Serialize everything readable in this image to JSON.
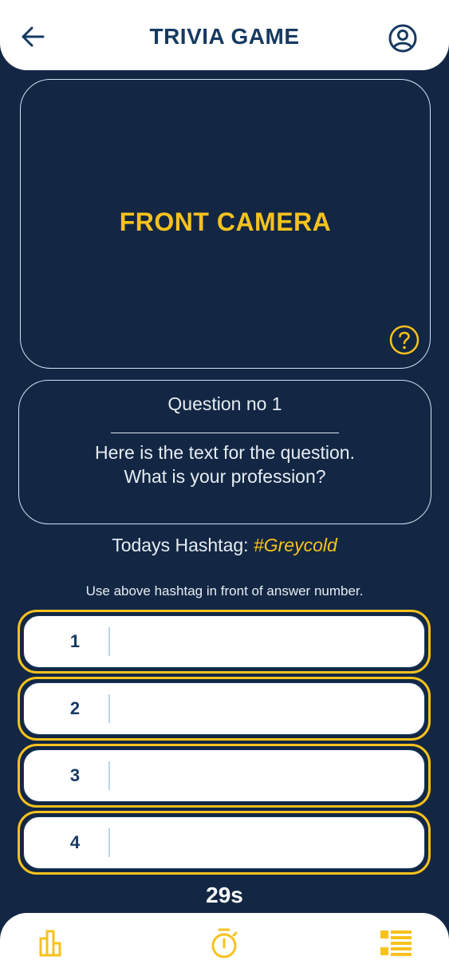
{
  "header": {
    "title": "TRIVIA GAME",
    "back_icon": "arrow-left-icon",
    "profile_icon": "user-circle-icon"
  },
  "camera": {
    "label": "FRONT CAMERA",
    "help_icon": "question-circle-icon"
  },
  "question": {
    "number_label": "Question no 1",
    "line1": "Here is the text for the question.",
    "line2": "What is your profession?"
  },
  "hashtag": {
    "prefix": "Todays Hashtag: ",
    "value": "#Greycold"
  },
  "instruction": "Use above hashtag in front of answer number.",
  "answers": [
    {
      "number": "1",
      "value": ""
    },
    {
      "number": "2",
      "value": ""
    },
    {
      "number": "3",
      "value": ""
    },
    {
      "number": "4",
      "value": ""
    }
  ],
  "timer": "29s",
  "nav": {
    "items": [
      {
        "icon": "bar-chart-icon"
      },
      {
        "icon": "stopwatch-icon"
      },
      {
        "icon": "list-icon"
      }
    ]
  },
  "colors": {
    "background": "#132744",
    "accent": "#f7c21d",
    "primary_text": "#173a61",
    "white": "#ffffff"
  }
}
